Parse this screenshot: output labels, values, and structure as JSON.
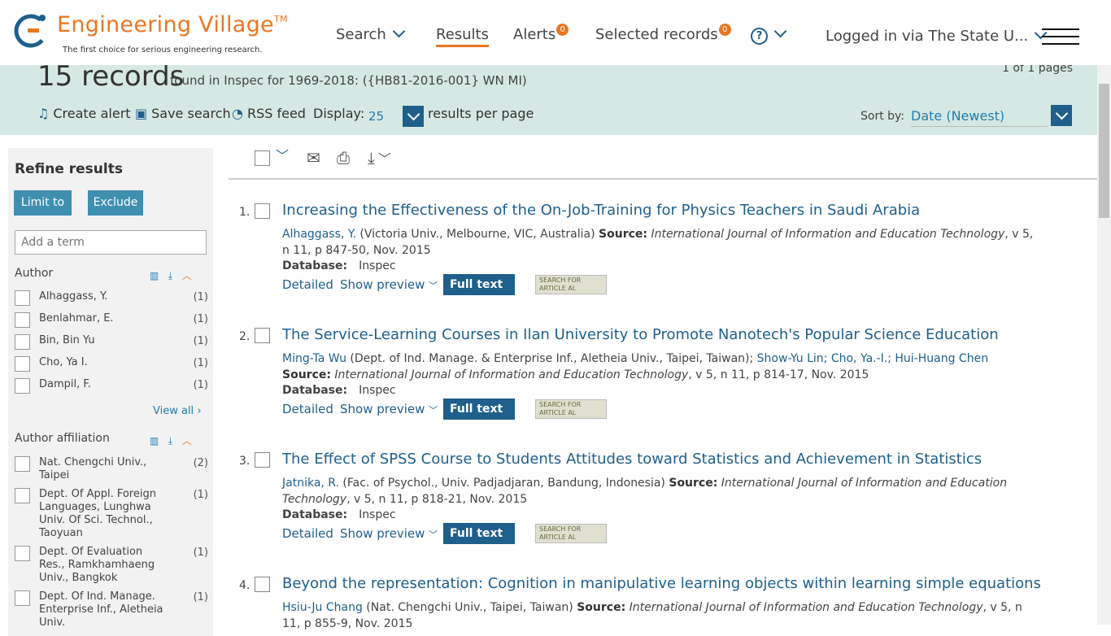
{
  "header": {
    "brand": "Engineering Village",
    "trademark": "TM",
    "tagline": "The first choice for serious engineering research.",
    "nav": {
      "search": "Search",
      "results": "Results",
      "alerts": "Alerts",
      "alerts_count": "0",
      "selected": "Selected records",
      "selected_count": "0",
      "help": "?",
      "login": "Logged in via The State U..."
    }
  },
  "summary": {
    "records": "15 records",
    "found": "found in Inspec for 1969-2018: ({HB81-2016-001} WN MI)",
    "pages": "1 of 1 pages",
    "create_alert": "Create alert",
    "save_search": "Save search",
    "rss": "RSS feed",
    "display_label": "Display:",
    "display_value": "25",
    "per_page": "results per page",
    "sort_label": "Sort by:",
    "sort_value": "Date (Newest)"
  },
  "sidebar": {
    "title": "Refine results",
    "limit": "Limit to",
    "exclude": "Exclude",
    "term_placeholder": "Add a term",
    "author_head": "Author",
    "authors": [
      {
        "name": "Alhaggass, Y.",
        "count": "(1)"
      },
      {
        "name": "Benlahmar, E.",
        "count": "(1)"
      },
      {
        "name": "Bin, Bin Yu",
        "count": "(1)"
      },
      {
        "name": "Cho, Ya I.",
        "count": "(1)"
      },
      {
        "name": "Dampil, F.",
        "count": "(1)"
      }
    ],
    "view_all": "View all",
    "affil_head": "Author affiliation",
    "affiliations": [
      {
        "name": "Nat. Chengchi Univ., Taipei",
        "count": "(2)"
      },
      {
        "name": "Dept. Of Appl. Foreign Languages, Lunghwa Univ. Of Sci. Technol., Taoyuan",
        "count": "(1)"
      },
      {
        "name": "Dept. Of Evaluation Res., Ramkhamhaeng Univ., Bangkok",
        "count": "(1)"
      },
      {
        "name": "Dept. Of Ind. Manage. Enterprise Inf., Aletheia Univ.",
        "count": "(1)"
      }
    ]
  },
  "results": [
    {
      "num": "1.",
      "title": "Increasing the Effectiveness of the On-Job-Training for Physics Teachers in Saudi Arabia",
      "authors": "Alhaggass, Y.",
      "affil": " (Victoria Univ., Melbourne, VIC, Australia) ",
      "source_label": "Source:",
      "source": " International Journal of Information and Education Technology",
      "citation": ", v 5, n 11, p 847-50, Nov. 2015",
      "db_label": "Database:",
      "db": "Inspec"
    },
    {
      "num": "2.",
      "title": "The Service-Learning Courses in Ilan University to Promote Nanotech's Popular Science Education",
      "authors": "Ming-Ta Wu",
      "affil": " (Dept. of Ind. Manage. & Enterprise Inf., Aletheia Univ., Taipei, Taiwan); ",
      "authors2": "Show-Yu Lin; Cho, Ya.-I.; Hui-Huang Chen",
      "source_label": " Source:",
      "source": " International Journal of Information and Education Technology",
      "citation": ", v 5, n 11, p 814-17, Nov. 2015",
      "db_label": "Database:",
      "db": "Inspec"
    },
    {
      "num": "3.",
      "title": "The Effect of SPSS Course to Students Attitudes toward Statistics and Achievement in Statistics",
      "authors": "Jatnika, R.",
      "affil": " (Fac. of Psychol., Univ. Padjadjaran, Bandung, Indonesia) ",
      "source_label": "Source:",
      "source": " International Journal of Information and Education Technology",
      "citation": ", v 5, n 11, p 818-21, Nov. 2015",
      "db_label": "Database:",
      "db": "Inspec"
    },
    {
      "num": "4.",
      "title": "Beyond the representation: Cognition in manipulative learning objects within learning simple equations",
      "authors": "Hsiu-Ju Chang",
      "affil": " (Nat. Chengchi Univ., Taipei, Taiwan) ",
      "source_label": "Source:",
      "source": " International Journal of Information and Education Technology",
      "citation": ", v 5, n 11, p 855-9, Nov. 2015"
    }
  ],
  "actions": {
    "detailed": "Detailed",
    "preview": "Show preview",
    "fulltext": "Full text",
    "article": "SEARCH FOR ARTICLE AL"
  }
}
